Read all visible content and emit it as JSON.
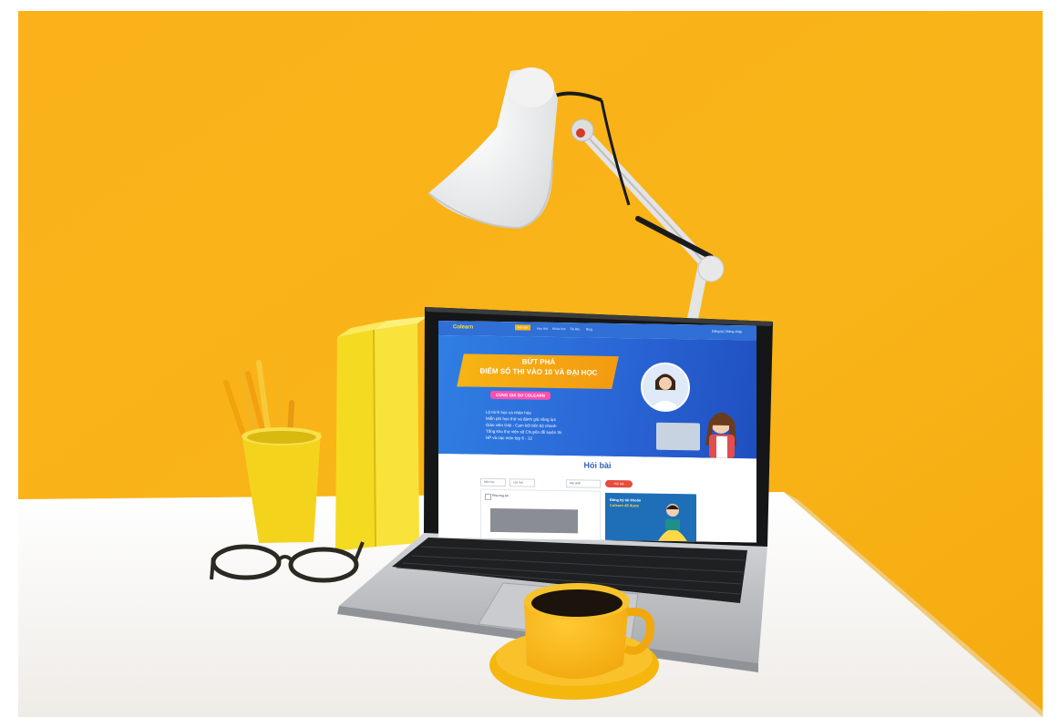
{
  "scene": {
    "colors": {
      "wall": "#f8b418",
      "desk": "#f2efea",
      "laptop_body": "#b9bcc0",
      "screen_bezel": "#151617",
      "yellow_objects": "#f4d51a",
      "cup": "#f4b510"
    },
    "icons": [
      "desk-lamp-icon",
      "pencil-cup-icon",
      "books-icon",
      "glasses-icon",
      "coffee-cup-icon"
    ]
  },
  "screen": {
    "logo": "Colearn",
    "nav": [
      "Hỏi bài",
      "Học thử",
      "Khóa học",
      "Tài liệu",
      "Blog"
    ],
    "login": "Đăng ký | Đăng nhập",
    "banner": {
      "headline_line1": "BỨT PHÁ",
      "headline_line2": "ĐIỂM SỐ THI VÀO 10 VÀ ĐẠI HỌC",
      "pill": "CÙNG GIA SƯ COLEARN",
      "bullets": [
        "Lộ trình học cá nhân hóa",
        "Miễn phí học thử và đánh giá năng lực",
        "Giáo viên Giỏi - Cam kết tiến bộ nhanh",
        "Tổng kho thư viện số Chuyên đề luyện thi",
        "HP và các môn lớp 6 - 12"
      ]
    },
    "title": "Hỏi bài",
    "filters": [
      "Môn học",
      "Lớp học",
      "Mới nhất"
    ],
    "post_button": "Hỏi bài",
    "card_label": "Phương án",
    "promo_title": "Đăng ký tài khoản",
    "promo_subtitle": "Colearn để được"
  }
}
